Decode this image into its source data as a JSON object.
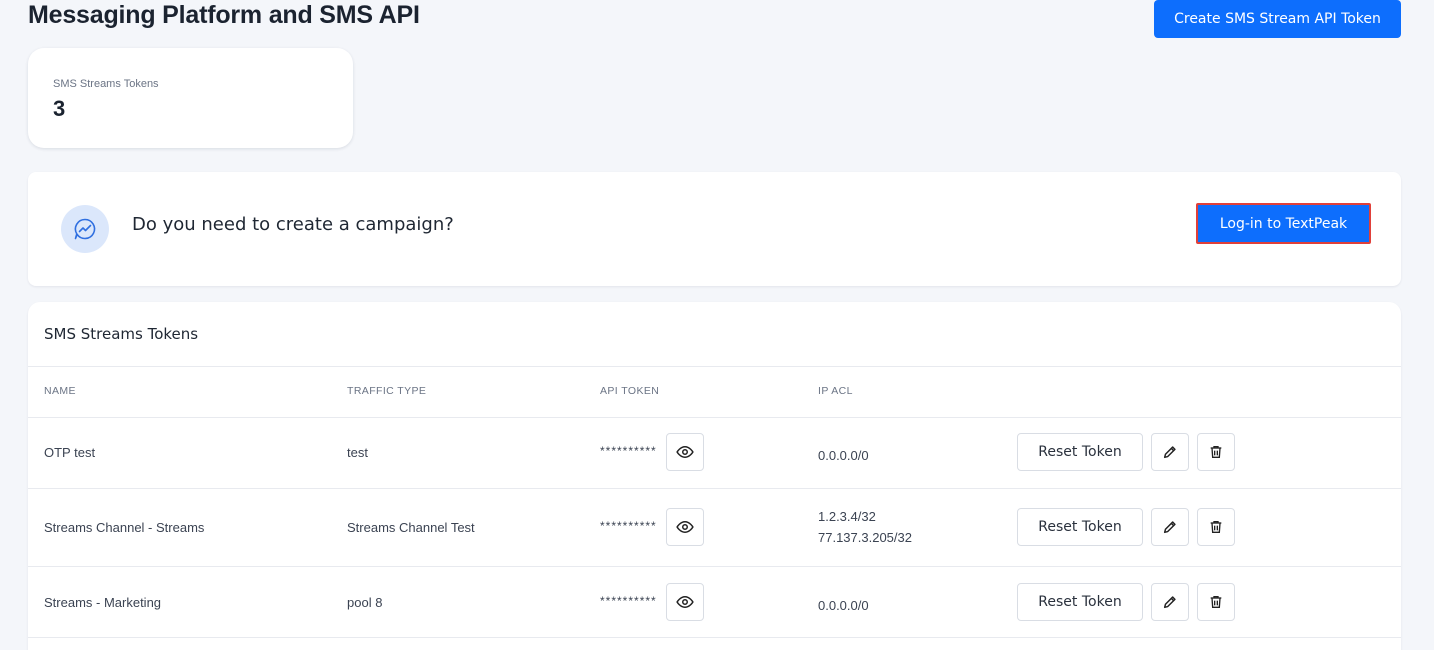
{
  "header": {
    "title": "Messaging Platform and SMS API",
    "create_button_label": "Create SMS Stream API Token"
  },
  "stat": {
    "label": "SMS Streams Tokens",
    "value": "3"
  },
  "campaign": {
    "question": "Do you need to create a campaign?",
    "login_button_label": "Log-in to TextPeak",
    "icon": "chat-chart-icon"
  },
  "tokens": {
    "title": "SMS Streams Tokens",
    "columns": [
      "NAME",
      "TRAFFIC TYPE",
      "API TOKEN",
      "IP ACL"
    ],
    "rows": [
      {
        "name": "OTP test",
        "traffic_type": "test",
        "api_token": "**********",
        "ip_acl": [
          "0.0.0.0/0"
        ],
        "reset_label": "Reset Token"
      },
      {
        "name": "Streams Channel - Streams",
        "traffic_type": "Streams Channel Test",
        "api_token": "**********",
        "ip_acl": [
          "1.2.3.4/32",
          "77.137.3.205/32"
        ],
        "reset_label": "Reset Token"
      },
      {
        "name": "Streams - Marketing",
        "traffic_type": "pool 8",
        "api_token": "**********",
        "ip_acl": [
          "0.0.0.0/0"
        ],
        "reset_label": "Reset Token"
      }
    ]
  },
  "colors": {
    "primary": "#0d6efd",
    "highlight_border": "#e0403a",
    "background": "#f4f6fa"
  }
}
